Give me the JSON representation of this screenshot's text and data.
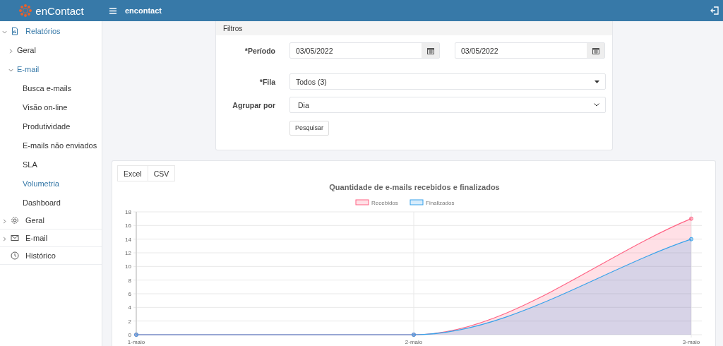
{
  "header": {
    "brand": "enContact",
    "title": "encontact"
  },
  "sidebar": {
    "items": [
      {
        "label": "Relatórios",
        "expanded": true,
        "children": [
          {
            "label": "Geral",
            "expanded": false,
            "selected": false
          },
          {
            "label": "E-mail",
            "expanded": true,
            "children": [
              {
                "label": "Busca e-mails",
                "selected": false
              },
              {
                "label": "Visão on-line",
                "selected": false
              },
              {
                "label": "Produtividade",
                "selected": false
              },
              {
                "label": "E-mails não enviados",
                "selected": false
              },
              {
                "label": "SLA",
                "selected": false
              },
              {
                "label": "Volumetria",
                "selected": true
              },
              {
                "label": "Dashboard",
                "selected": false
              }
            ]
          }
        ]
      },
      {
        "label": "Geral",
        "expanded": false,
        "selected": false
      },
      {
        "label": "E-mail",
        "expanded": false,
        "selected": false
      },
      {
        "label": "Histórico",
        "selected": false
      }
    ]
  },
  "filters": {
    "title": "Filtros",
    "period": {
      "label": "*Período",
      "from": "03/05/2022",
      "to": "03/05/2022"
    },
    "queue": {
      "label": "*Fila",
      "value": "Todos (3)"
    },
    "group_by": {
      "label": "Agrupar por",
      "value": "Dia"
    },
    "submit": "Pesquisar"
  },
  "report": {
    "export_buttons": [
      "Excel",
      "CSV"
    ],
    "chart_data": {
      "type": "area",
      "title": "Quantidade de e-mails recebidos e finalizados",
      "categories": [
        "1-maio",
        "2-maio",
        "3-maio"
      ],
      "ylim": [
        0,
        18
      ],
      "grid": true,
      "legend": true,
      "yticks": [
        0,
        2,
        4,
        6,
        8,
        10,
        12,
        14,
        16,
        18
      ],
      "series": [
        {
          "name": "Recebidos",
          "color": "#ff6384",
          "values": [
            0,
            0,
            17
          ]
        },
        {
          "name": "Finalizados",
          "color": "#36a2eb",
          "values": [
            0,
            0,
            14
          ]
        }
      ]
    }
  }
}
